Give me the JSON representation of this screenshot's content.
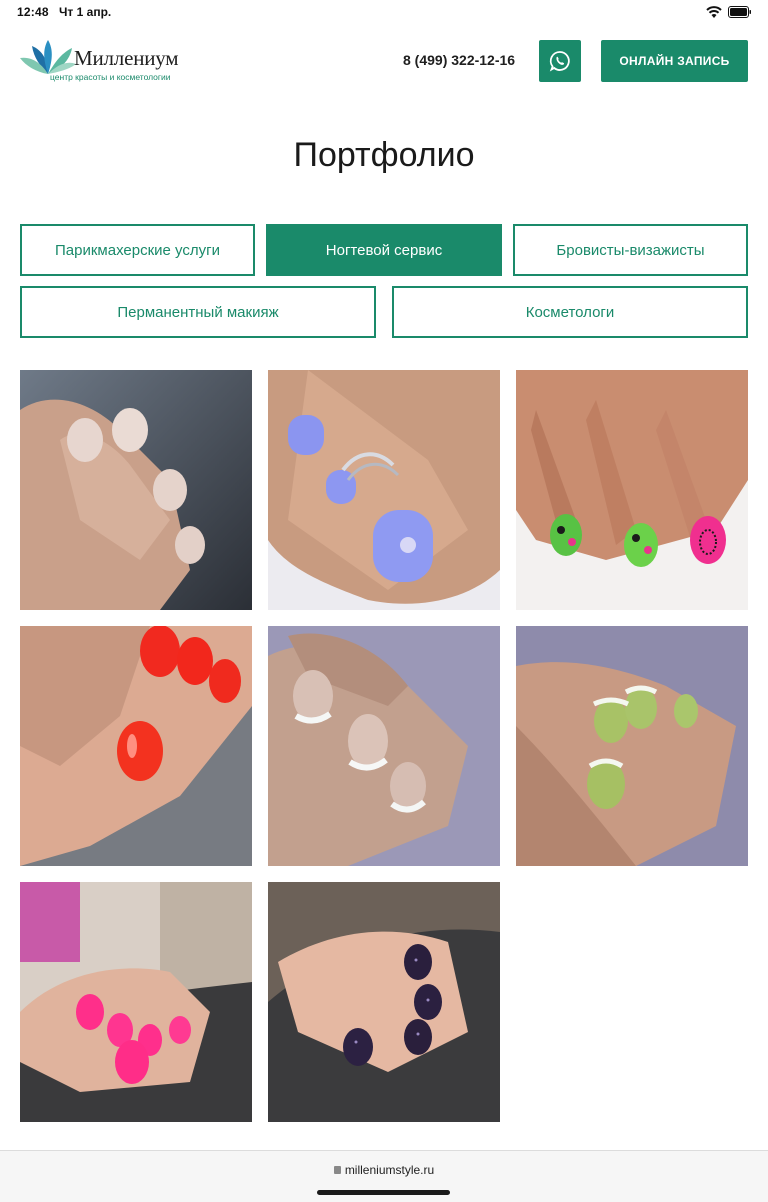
{
  "status": {
    "time": "12:48",
    "date": "Чт 1 апр."
  },
  "header": {
    "logo_name": "Миллениум",
    "logo_tagline": "центр красоты и косметологии",
    "phone": "8 (499) 322-12-16",
    "whatsapp_icon": "whatsapp-icon",
    "book_button": "ОНЛАЙН ЗАПИСЬ"
  },
  "colors": {
    "brand": "#1a8a6a",
    "text": "#1b1b1b"
  },
  "page": {
    "title": "Портфолио"
  },
  "tabs": [
    {
      "label": "Парикмахерские услуги",
      "active": false
    },
    {
      "label": "Ногтевой сервис",
      "active": true
    },
    {
      "label": "Бровисты-визажисты",
      "active": false
    },
    {
      "label": "Перманентный макияж",
      "active": false
    },
    {
      "label": "Косметологи",
      "active": false
    }
  ],
  "gallery": [
    {
      "subject": "nude manicure"
    },
    {
      "subject": "lavender pedicure with ring"
    },
    {
      "subject": "green and pink leopard nail art"
    },
    {
      "subject": "red manicure"
    },
    {
      "subject": "french manicure"
    },
    {
      "subject": "green french manicure"
    },
    {
      "subject": "pink manicure"
    },
    {
      "subject": "dark glitter manicure"
    }
  ],
  "browser": {
    "url": "milleniumstyle.ru"
  }
}
